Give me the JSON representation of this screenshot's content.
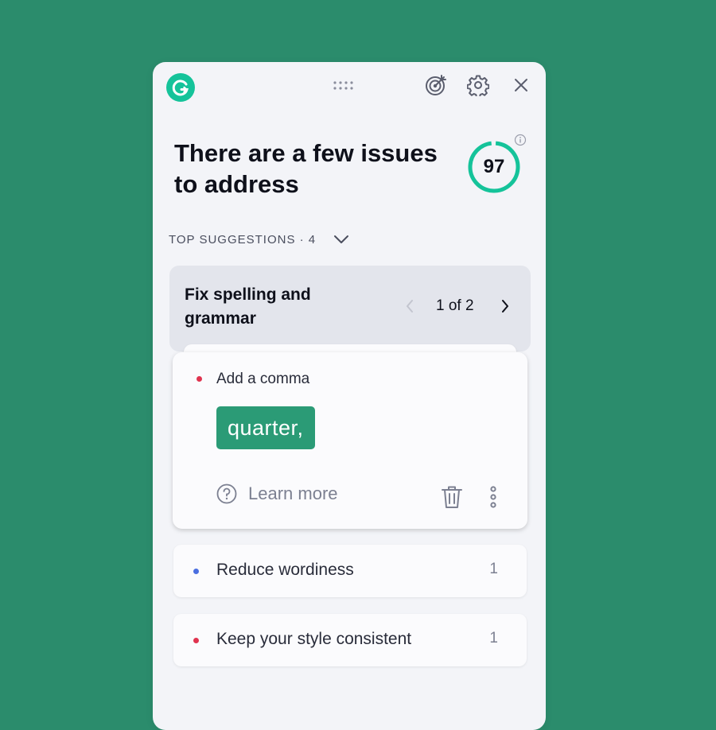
{
  "header": {
    "title": "There are a few issues to address",
    "score": "97"
  },
  "suggestions": {
    "section_label": "TOP SUGGESTIONS · 4",
    "group": {
      "title": "Fix spelling and grammar",
      "pager": "1 of 2"
    },
    "alert": {
      "title": "Add a comma",
      "replacement": "quarter,",
      "learn_more": "Learn more"
    },
    "categories": [
      {
        "label": "Reduce wordiness",
        "count": "1",
        "color": "#4a6ee0"
      },
      {
        "label": "Keep your style consistent",
        "count": "1",
        "color": "#e0334f"
      }
    ]
  },
  "colors": {
    "background": "#2b8c6c",
    "brand": "#15c39a",
    "suggestion": "#2b9b76",
    "correctness": "#e0334f",
    "clarity": "#4a6ee0"
  },
  "icons": [
    "grammarly-logo",
    "drag-handle-icon",
    "goals-target-icon",
    "gear-icon",
    "close-icon",
    "info-icon",
    "chevron-down-icon",
    "chevron-left-icon",
    "chevron-right-icon",
    "help-circle-icon",
    "trash-icon",
    "more-vertical-icon"
  ]
}
